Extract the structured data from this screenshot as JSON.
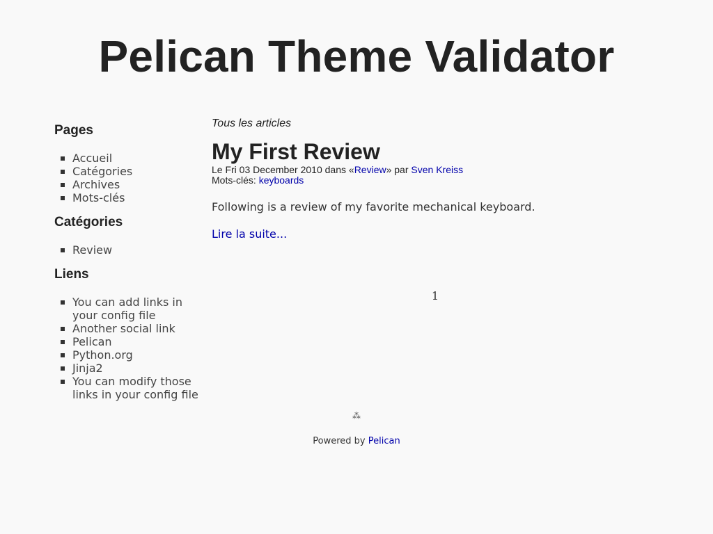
{
  "site": {
    "title": "Pelican Theme Validator"
  },
  "sidebar": {
    "pages_heading": "Pages",
    "pages": [
      "Accueil",
      "Catégories",
      "Archives",
      "Mots-clés"
    ],
    "categories_heading": "Catégories",
    "categories": [
      "Review"
    ],
    "links_heading": "Liens",
    "links": [
      "You can add links in your config file",
      "Another social link",
      "Pelican",
      "Python.org",
      "Jinja2",
      "You can modify those links in your config file"
    ]
  },
  "main": {
    "all_articles": "Tous les articles",
    "article": {
      "title": "My First Review",
      "date_prefix": "Le Fri 03 December 2010 dans «",
      "category": "Review",
      "author_prefix": "» par ",
      "author": "Sven Kreiss",
      "tags_label": "Mots-clés: ",
      "tag": "keyboards",
      "summary": "Following is a review of my favorite mechanical keyboard.",
      "read_more": "Lire la suite..."
    },
    "pagination": {
      "current_page": "1"
    }
  },
  "footer": {
    "icon": "pelican-icon",
    "icon_glyph": "⁂",
    "powered_by": "Powered by ",
    "pelican_link": "Pelican"
  },
  "colors": {
    "background": "#f9f9f9",
    "text": "#222222",
    "link": "#0000aa"
  }
}
